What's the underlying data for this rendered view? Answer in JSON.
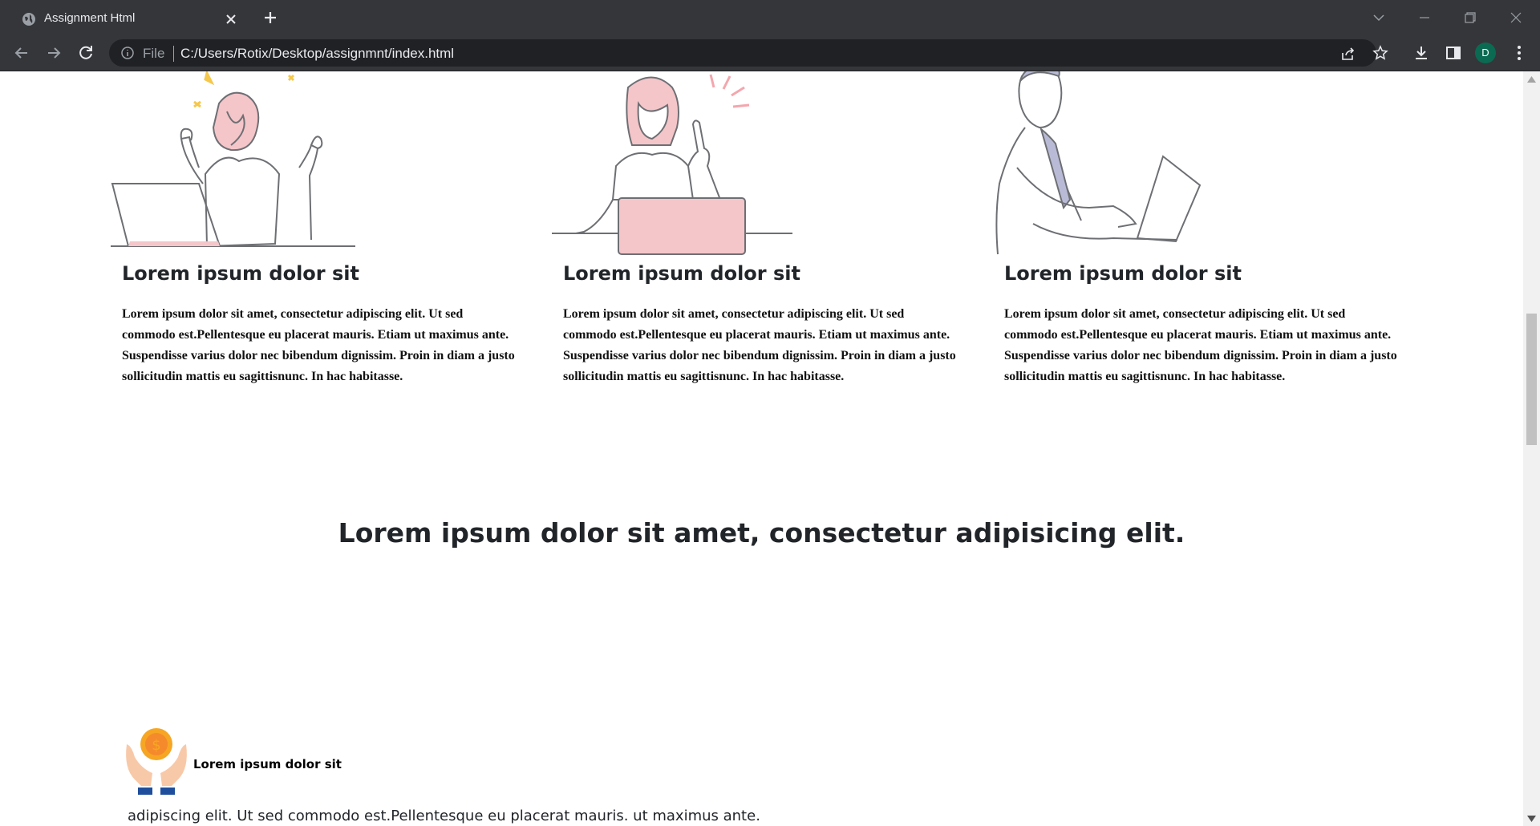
{
  "browser": {
    "tab_title": "Assignment Html",
    "file_label": "File",
    "url": "C:/Users/Rotix/Desktop/assignmnt/index.html",
    "profile_initial": "D"
  },
  "cards": [
    {
      "title": "Lorem ipsum dolor sit",
      "text": "Lorem ipsum dolor sit amet, consectetur adipiscing elit. Ut sed commodo est.Pellentesque eu placerat mauris. Etiam ut maximus ante. Suspendisse varius dolor nec bibendum dignissim. Proin in diam a justo sollicitudin mattis eu sagittisnunc. In hac habitasse."
    },
    {
      "title": "Lorem ipsum dolor sit",
      "text": "Lorem ipsum dolor sit amet, consectetur adipiscing elit. Ut sed commodo est.Pellentesque eu placerat mauris. Etiam ut maximus ante. Suspendisse varius dolor nec bibendum dignissim. Proin in diam a justo sollicitudin mattis eu sagittisnunc. In hac habitasse."
    },
    {
      "title": "Lorem ipsum dolor sit",
      "text": "Lorem ipsum dolor sit amet, consectetur adipiscing elit. Ut sed commodo est.Pellentesque eu placerat mauris. Etiam ut maximus ante. Suspendisse varius dolor nec bibendum dignissim. Proin in diam a justo sollicitudin mattis eu sagittisnunc. In hac habitasse."
    }
  ],
  "headline": "Lorem ipsum dolor sit amet, consectetur adipisicing elit.",
  "feature": {
    "icon": "money-hands-icon",
    "title": "Lorem ipsum dolor sit",
    "text": "adipiscing elit. Ut sed commodo est.Pellentesque eu placerat mauris. ut maximus ante."
  },
  "colors": {
    "chrome_bg": "#35363a",
    "omnibox_bg": "#202124",
    "accent_pink": "#f4c5c9",
    "avatar_bg": "#0b6a52"
  }
}
